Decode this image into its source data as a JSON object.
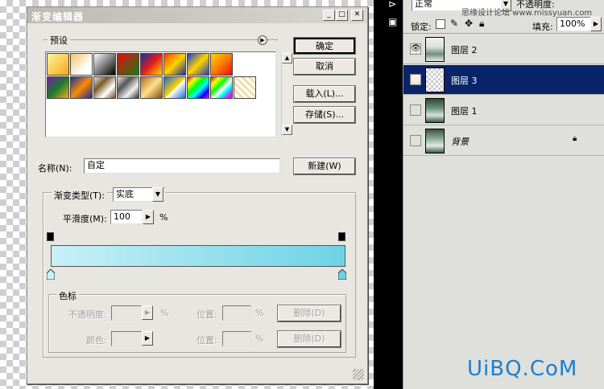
{
  "dialog": {
    "title": "渐变编辑器",
    "presets_label": "预设",
    "buttons": {
      "ok": "确定",
      "cancel": "取消",
      "load": "载入(L)...",
      "save": "存储(S)...",
      "new": "新建(W)"
    },
    "name_label": "名称(N):",
    "name_value": "自定",
    "gradient_type_label": "渐变类型(T):",
    "gradient_type_value": "实底",
    "smoothness_label": "平滑度(M):",
    "smoothness_value": "100",
    "percent": "%",
    "color_stops_label": "色标",
    "opacity_label": "不透明度:",
    "color_label": "颜色:",
    "location_label": "位置:",
    "delete_label": "删除(D)",
    "gradient_colors": {
      "start": "#c8f0f6",
      "end": "#6dd3e4"
    }
  },
  "layers_panel": {
    "blend_mode": "正常",
    "opacity_label": "不透明度:",
    "lock_label": "锁定:",
    "fill_label": "填充:",
    "fill_value": "100%",
    "watermark": "思缘设计论坛 www.missyuan.com",
    "layers": [
      {
        "name": "图层 2",
        "visible": true,
        "selected": false
      },
      {
        "name": "图层 3",
        "visible": true,
        "selected": true
      },
      {
        "name": "图层 1",
        "visible": false,
        "selected": false
      },
      {
        "name": "背景",
        "visible": false,
        "selected": false
      }
    ]
  },
  "site_logo": "UiBQ.CoM"
}
